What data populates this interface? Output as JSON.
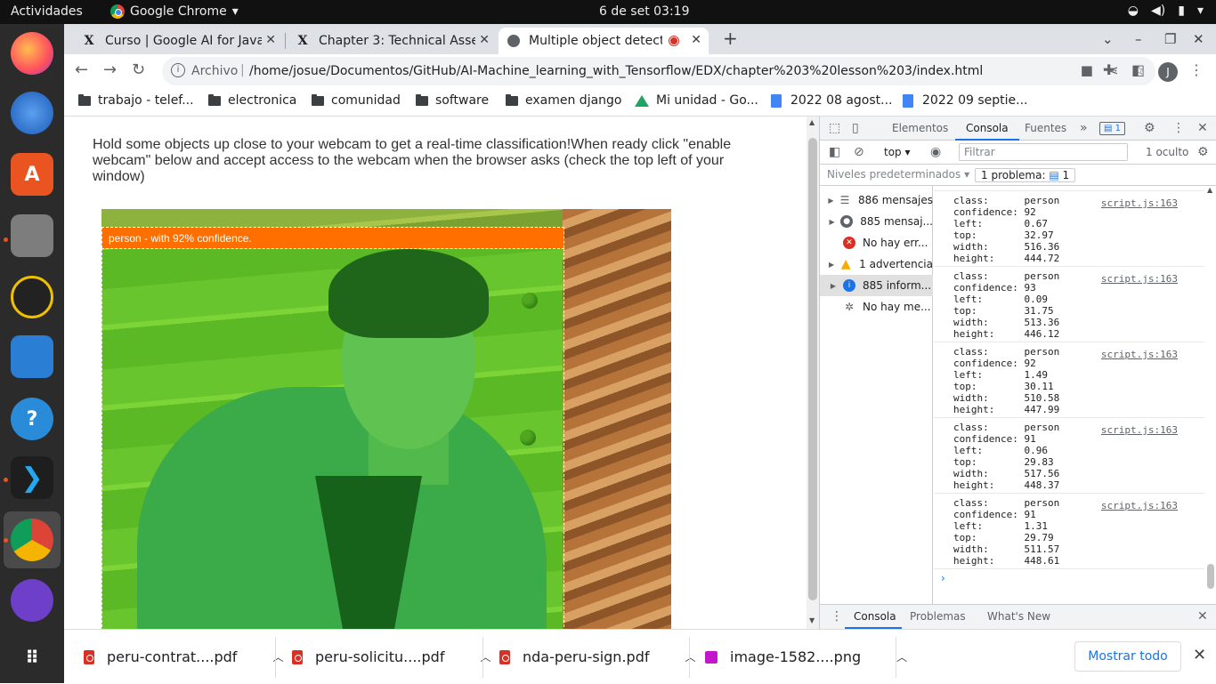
{
  "os": {
    "activities": "Actividades",
    "app_name": "Google Chrome",
    "clock": "6 de set  03:19"
  },
  "tabs": [
    {
      "title": "Curso | Google AI for Java",
      "favicon": "x-icon"
    },
    {
      "title": "Chapter 3: Technical Asse",
      "favicon": "x-icon"
    },
    {
      "title": "Multiple object detecti",
      "favicon": "globe-icon",
      "recording": true
    }
  ],
  "toolbar": {
    "scheme": "Archivo",
    "url": "/home/josue/Documentos/GitHub/AI-Machine_learning_with_Tensorflow/EDX/chapter%203%20lesson%203/index.html",
    "profile_initial": "J"
  },
  "bookmarks": [
    {
      "label": "trabajo - telef...",
      "icon": "folder-icon"
    },
    {
      "label": "electronica",
      "icon": "folder-icon"
    },
    {
      "label": "comunidad",
      "icon": "folder-icon"
    },
    {
      "label": "software",
      "icon": "folder-icon"
    },
    {
      "label": "examen django",
      "icon": "folder-icon"
    },
    {
      "label": "Mi unidad - Go...",
      "icon": "drive-icon"
    },
    {
      "label": "2022 08 agost...",
      "icon": "doc-icon"
    },
    {
      "label": "2022 09 septie...",
      "icon": "doc-icon"
    }
  ],
  "page": {
    "intro": "Hold some objects up close to your webcam to get a real-time classification!When ready click \"enable webcam\" below and accept access to the webcam when the browser asks (check the top left of your window)",
    "detection_label": "person - with 92% confidence."
  },
  "devtools": {
    "tabs": [
      "Elementos",
      "Consola",
      "Fuentes"
    ],
    "issues_badge": "1",
    "context": "top",
    "filter_placeholder": "Filtrar",
    "hidden_count": "1 oculto",
    "levels": "Niveles predeterminados",
    "problem_badge": "1 problema:",
    "problem_count": "1",
    "sidebar": [
      {
        "label": "886 mensajes",
        "icon": "list-icon"
      },
      {
        "label": "885 mensaj...",
        "icon": "user-icon"
      },
      {
        "label": "No hay err...",
        "icon": "error-icon"
      },
      {
        "label": "1 advertencia",
        "icon": "warning-icon"
      },
      {
        "label": "885 inform...",
        "icon": "info-icon"
      },
      {
        "label": "No hay me...",
        "icon": "bug-icon"
      }
    ],
    "logs": [
      {
        "class": "person",
        "confidence": "92",
        "left": "0.67",
        "top": "32.97",
        "width": "516.36",
        "height": "444.72",
        "source": "script.js:163"
      },
      {
        "class": "person",
        "confidence": "93",
        "left": "0.09",
        "top": "31.75",
        "width": "513.36",
        "height": "446.12",
        "source": "script.js:163"
      },
      {
        "class": "person",
        "confidence": "92",
        "left": "1.49",
        "top": "30.11",
        "width": "510.58",
        "height": "447.99",
        "source": "script.js:163"
      },
      {
        "class": "person",
        "confidence": "91",
        "left": "0.96",
        "top": "29.83",
        "width": "517.56",
        "height": "448.37",
        "source": "script.js:163"
      },
      {
        "class": "person",
        "confidence": "91",
        "left": "1.31",
        "top": "29.79",
        "width": "511.57",
        "height": "448.61",
        "source": "script.js:163"
      }
    ],
    "drawer_tabs": [
      "Consola",
      "Problemas",
      "What's New"
    ]
  },
  "downloads": {
    "items": [
      {
        "name": "peru-contrat....pdf",
        "type": "pdf"
      },
      {
        "name": "peru-solicitu....pdf",
        "type": "pdf"
      },
      {
        "name": "nda-peru-sign.pdf",
        "type": "pdf"
      },
      {
        "name": "image-1582....png",
        "type": "png"
      }
    ],
    "show_all": "Mostrar todo"
  }
}
